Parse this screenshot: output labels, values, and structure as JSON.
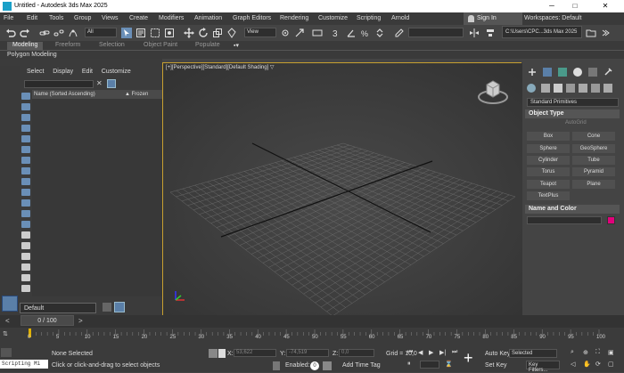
{
  "window": {
    "title": "Untitled - Autodesk 3ds Max 2025",
    "min_glyph": "─",
    "max_glyph": "□",
    "close_glyph": "✕"
  },
  "menubar": {
    "items": [
      "File",
      "Edit",
      "Tools",
      "Group",
      "Views",
      "Create",
      "Modifiers",
      "Animation",
      "Graph Editors",
      "Rendering",
      "Customize",
      "Scripting",
      "Arnold"
    ],
    "sign_in": "Sign In",
    "workspace_label": "Workspaces:",
    "workspace_value": "Default"
  },
  "toolbar": {
    "selection_filter": "All",
    "reference_coord": "View",
    "named_selection": "",
    "project_path": "C:\\Users\\CPC...3ds Max 2025"
  },
  "ribbon": {
    "tabs": [
      "Modeling",
      "Freeform",
      "Selection",
      "Object Paint",
      "Populate"
    ],
    "active_tab": "Modeling",
    "panel_label": "Polygon Modeling"
  },
  "scene_explorer": {
    "menu": [
      "Select",
      "Display",
      "Edit",
      "Customize"
    ],
    "col_name": "Name (Sorted Ascending)",
    "col_frozen": "▲ Frozen",
    "layer": "Default"
  },
  "viewport": {
    "label": "[+][Perspective][Standard][Default Shading]",
    "filter_glyph": "▽"
  },
  "command_panel": {
    "category": "Standard Primitives",
    "object_type_label": "Object Type",
    "autogrid_label": "AutoGrid",
    "primitives": [
      "Box",
      "Cone",
      "Sphere",
      "GeoSphere",
      "Cylinder",
      "Tube",
      "Torus",
      "Pyramid",
      "Teapot",
      "Plane",
      "TextPlus"
    ],
    "name_color_label": "Name and Color",
    "color": "#e2007b"
  },
  "timeline": {
    "frame": "0 / 100",
    "ticks": [
      "0",
      "5",
      "10",
      "15",
      "20",
      "25",
      "30",
      "35",
      "40",
      "45",
      "50",
      "55",
      "60",
      "65",
      "70",
      "75",
      "80",
      "85",
      "90",
      "95",
      "100"
    ]
  },
  "status": {
    "script_listener": "Scripting Mi",
    "selection": "None Selected",
    "prompt": "Click or click-and-drag to select objects",
    "x_label": "X:",
    "x_value": "53,622",
    "y_label": "Y:",
    "y_value": "-74,519",
    "z_label": "Z:",
    "z_value": "0,0",
    "grid": "Grid = 10,0",
    "enabled_label": "Enabled:",
    "enabled_value": "0",
    "add_time_tag": "Add Time Tag",
    "auto_key": "Auto Key",
    "set_key": "Set Key",
    "key_selection": "Selected",
    "key_filters": "Key Filters..."
  }
}
